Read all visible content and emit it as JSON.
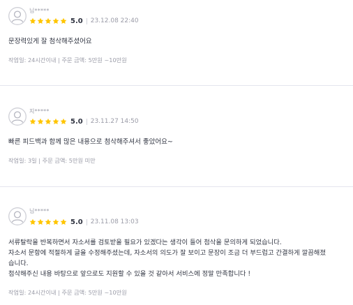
{
  "colors": {
    "star": "#ffc500",
    "text": "#303441",
    "muted": "#9a9ba7",
    "divider": "#e4e5ed"
  },
  "icons": {
    "avatar": "user-avatar-icon",
    "star": "star-icon"
  },
  "reviews": [
    {
      "name": "님*****",
      "rating": 5,
      "score": "5.0",
      "date": "23.12.08 22:40",
      "body": [
        "문장력있게 잘 첨삭해주셨어요"
      ],
      "meta": "작업일: 24시간이내 | 주문 금액: 5만원 ~10만원"
    },
    {
      "name": "지*****",
      "rating": 5,
      "score": "5.0",
      "date": "23.11.27 14:50",
      "body": [
        "빠른 피드백과 함께 많은 내용으로 첨삭해주셔서 좋았어요~"
      ],
      "meta": "작업일: 3일 | 주문 금액: 5만원 미만"
    },
    {
      "name": "님*****",
      "rating": 5,
      "score": "5.0",
      "date": "23.11.08 13:03",
      "body": [
        "서류탈락을 반복하면서 자소서를 검토받을 필요가 있겠다는 생각이 들어 첨삭을 문의하게 되었습니다.",
        "자소서 문항에 적절하게 글을 수정해주셨는데, 자소서의 의도가 잘 보이고 문장이 조금 더 부드럽고 간결하게 깔끔해졌",
        "습니다.",
        "첨삭해주신 내용 바탕으로 앞으로도 지원할 수 있을 것 같아서 서비스에 정말 만족합니다 !"
      ],
      "meta": "작업일: 24시간이내 | 주문 금액: 5만원 ~10만원"
    }
  ]
}
